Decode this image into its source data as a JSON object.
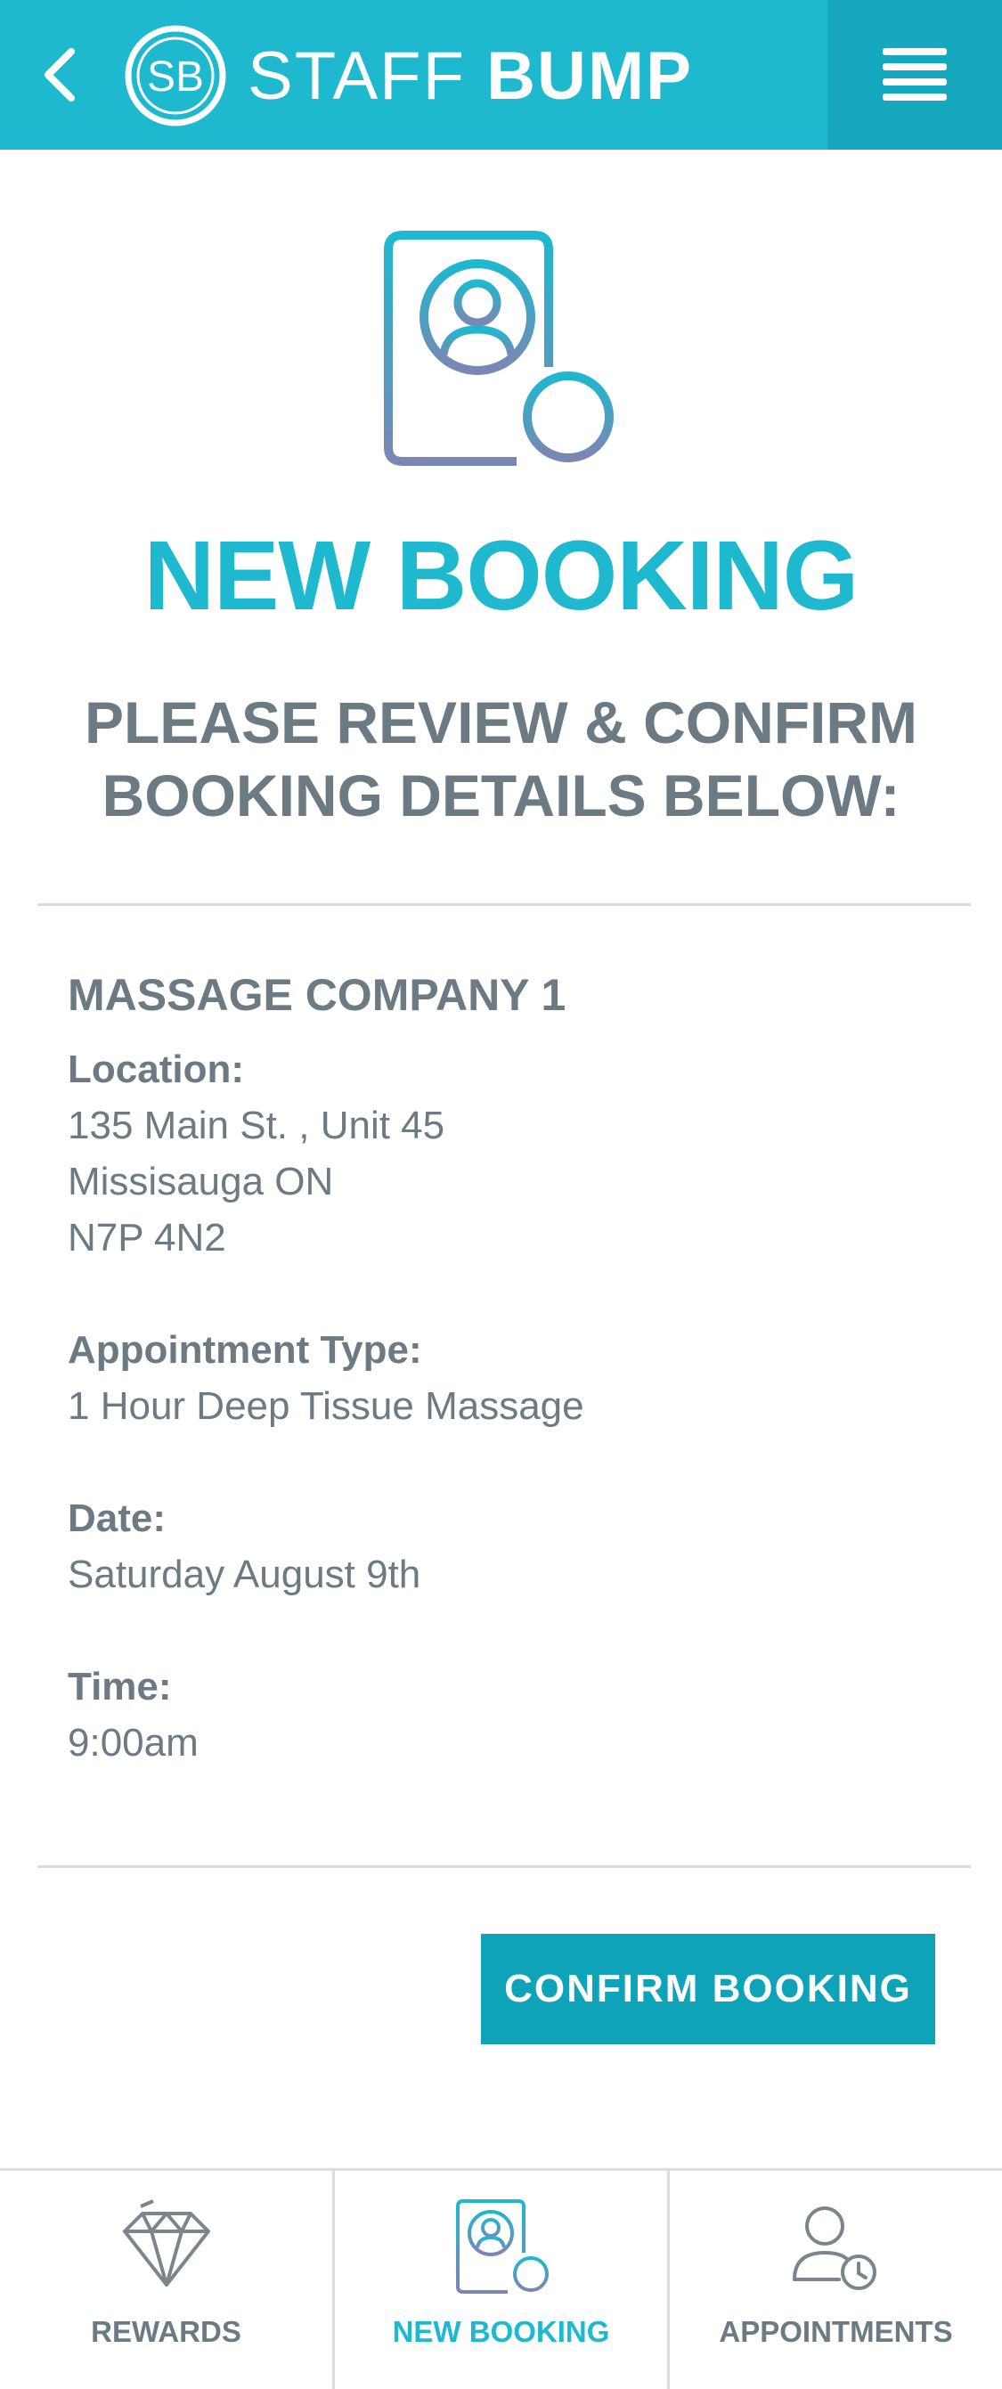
{
  "header": {
    "logo_initials": "SB",
    "logo_text_light": "STAFF ",
    "logo_text_bold": "BUMP",
    "colors": {
      "bar": "#1eb8cf",
      "menu_block": "#14a7bd"
    },
    "icons": {
      "back": "chevron-left-icon",
      "menu": "hamburger-icon"
    }
  },
  "main": {
    "hero_icon": "add-contact-card-icon",
    "title": "NEW BOOKING",
    "subtitle": "PLEASE REVIEW & CONFIRM BOOKING DETAILS BELOW:"
  },
  "details": {
    "company": "MASSAGE COMPANY 1",
    "location_label": "Location:",
    "location_line1": "135 Main St. , Unit 45",
    "location_line2": "Missisauga ON",
    "location_line3": "N7P 4N2",
    "appointment_label": "Appointment Type:",
    "appointment_value": "1 Hour Deep Tissue Massage",
    "date_label": "Date:",
    "date_value": "Saturday August 9th",
    "time_label": "Time:",
    "time_value": "9:00am"
  },
  "actions": {
    "confirm_label": "CONFIRM BOOKING",
    "confirm_color": "#0ea3b8"
  },
  "bottom_nav": {
    "items": [
      {
        "label": "REWARDS",
        "icon": "diamond-icon",
        "active": false
      },
      {
        "label": "NEW BOOKING",
        "icon": "add-contact-card-icon",
        "active": true
      },
      {
        "label": "APPOINTMENTS",
        "icon": "user-clock-icon",
        "active": false
      }
    ],
    "active_color": "#1eb8cf",
    "inactive_color": "#6b7a83"
  }
}
